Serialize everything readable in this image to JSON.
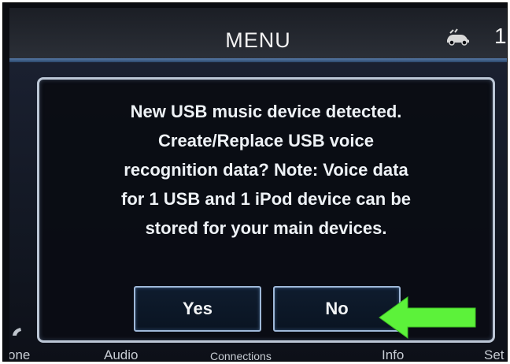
{
  "header": {
    "title": "MENU",
    "clock_fragment": "1",
    "status_icon": "car-icon"
  },
  "dialog": {
    "message_lines": [
      "New USB music device detected.",
      "Create/Replace USB voice",
      "recognition data? Note: Voice data",
      "for 1 USB and 1 iPod device can be",
      "stored for your main devices."
    ],
    "yes_label": "Yes",
    "no_label": "No"
  },
  "bottom_nav": {
    "items": [
      "one",
      "Audio",
      "Connections",
      "Info",
      "Set"
    ]
  },
  "annotation": {
    "arrow_color": "#5cf23a",
    "points_to": "No"
  },
  "colors": {
    "screen_bg": "#0f131b",
    "dialog_border": "#bcc7d6",
    "button_border": "#9fb8d8",
    "text": "#eef2f6"
  }
}
